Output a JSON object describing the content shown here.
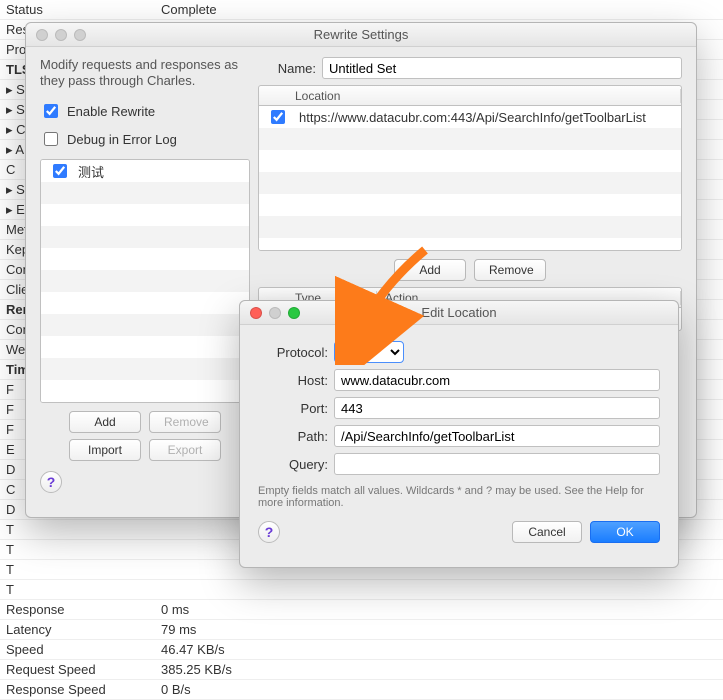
{
  "statusRows": [
    {
      "k": "Status",
      "v": "Complete",
      "bold": false
    },
    {
      "k": "Resp",
      "v": ""
    },
    {
      "k": "Prot",
      "v": ""
    },
    {
      "k": "TLS",
      "v": "",
      "bold": true
    },
    {
      "k": "▸ S",
      "v": ""
    },
    {
      "k": "▸ S",
      "v": ""
    },
    {
      "k": "▸ C",
      "v": ""
    },
    {
      "k": "▸ A",
      "v": ""
    },
    {
      "k": "   C",
      "v": ""
    },
    {
      "k": "▸ S",
      "v": ""
    },
    {
      "k": "▸ E",
      "v": ""
    },
    {
      "k": "Meth",
      "v": ""
    },
    {
      "k": "Kep",
      "v": ""
    },
    {
      "k": "Con",
      "v": ""
    },
    {
      "k": "Clie",
      "v": ""
    },
    {
      "k": "Rem",
      "v": "",
      "bold": true
    },
    {
      "k": "Con",
      "v": ""
    },
    {
      "k": "Web",
      "v": ""
    },
    {
      "k": "Tim",
      "v": "",
      "bold": true
    },
    {
      "k": "   F",
      "v": ""
    },
    {
      "k": "   F",
      "v": ""
    },
    {
      "k": "   F",
      "v": ""
    },
    {
      "k": "   E",
      "v": ""
    },
    {
      "k": "   D",
      "v": ""
    },
    {
      "k": "   C",
      "v": ""
    },
    {
      "k": "   D",
      "v": ""
    },
    {
      "k": "   T",
      "v": ""
    },
    {
      "k": "   T",
      "v": ""
    },
    {
      "k": "   T",
      "v": ""
    },
    {
      "k": "   T",
      "v": ""
    },
    {
      "k": "Response",
      "v": "0 ms"
    },
    {
      "k": "Latency",
      "v": "79 ms"
    },
    {
      "k": "Speed",
      "v": "46.47 KB/s"
    },
    {
      "k": "Request Speed",
      "v": "385.25 KB/s"
    },
    {
      "k": "Response Speed",
      "v": "0 B/s"
    }
  ],
  "rewriteWin": {
    "title": "Rewrite Settings",
    "intro": "Modify requests and responses as they pass through Charles.",
    "enableLabel": "Enable Rewrite",
    "debugLabel": "Debug in Error Log",
    "enableChecked": true,
    "debugChecked": false,
    "sets": [
      "测试"
    ],
    "leftBtns": {
      "add": "Add",
      "remove": "Remove",
      "import": "Import",
      "export": "Export"
    },
    "nameLabel": "Name:",
    "nameValue": "Untitled Set",
    "locHeader": "Location",
    "locations": [
      "https://www.datacubr.com:443/Api/SearchInfo/getToolbarList"
    ],
    "locBtns": {
      "add": "Add",
      "remove": "Remove"
    },
    "rulesHeaders": {
      "type": "Type",
      "action": "Action"
    }
  },
  "editLoc": {
    "title": "Edit Location",
    "protocolLabel": "Protocol:",
    "protocolValue": "https",
    "hostLabel": "Host:",
    "hostValue": "www.datacubr.com",
    "portLabel": "Port:",
    "portValue": "443",
    "pathLabel": "Path:",
    "pathValue": "/Api/SearchInfo/getToolbarList",
    "queryLabel": "Query:",
    "queryValue": "",
    "note": "Empty fields match all values. Wildcards * and ? may be used. See the Help for more information.",
    "cancel": "Cancel",
    "ok": "OK"
  }
}
